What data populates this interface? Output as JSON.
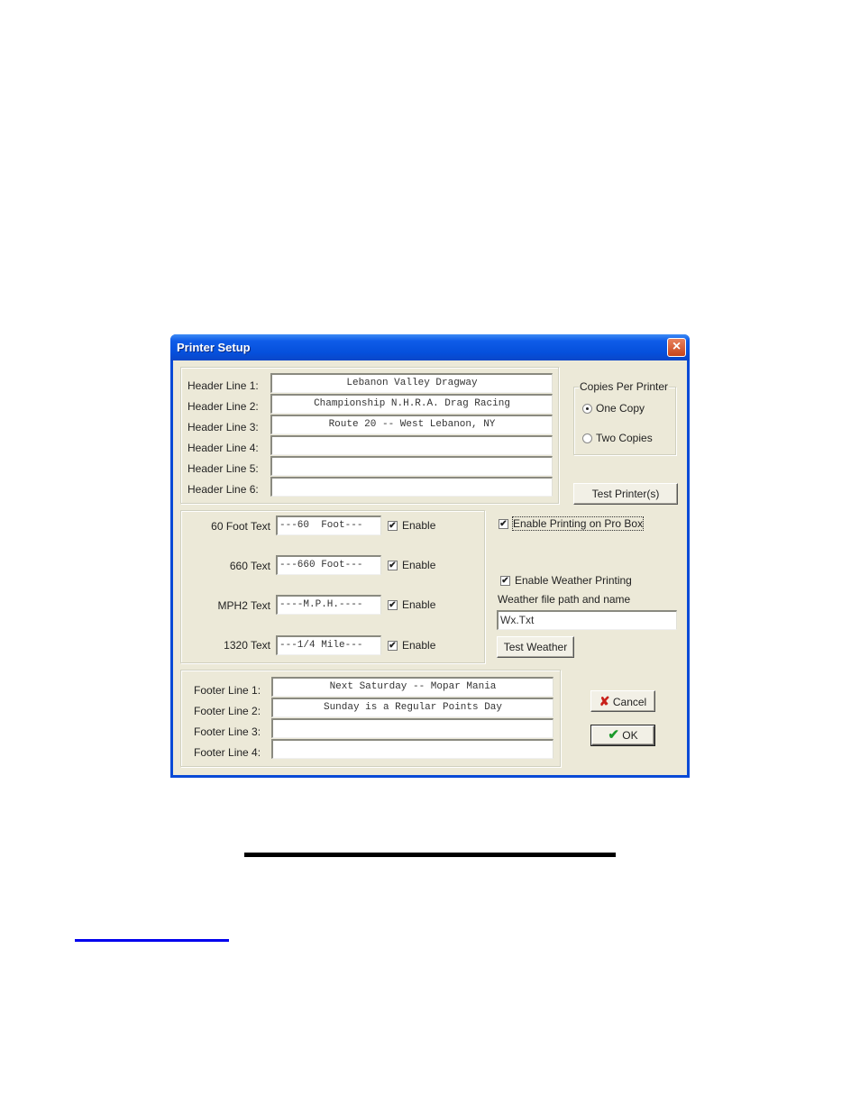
{
  "window": {
    "title": "Printer Setup",
    "close_icon": "close-icon"
  },
  "header_lines": [
    {
      "label": "Header Line 1:",
      "value": "Lebanon Valley Dragway"
    },
    {
      "label": "Header Line 2:",
      "value": "Championship N.H.R.A. Drag Racing"
    },
    {
      "label": "Header Line 3:",
      "value": "Route 20 -- West Lebanon, NY"
    },
    {
      "label": "Header Line 4:",
      "value": ""
    },
    {
      "label": "Header Line 5:",
      "value": ""
    },
    {
      "label": "Header Line 6:",
      "value": ""
    }
  ],
  "copies": {
    "legend": "Copies Per Printer",
    "options": [
      {
        "label": "One Copy",
        "selected": true
      },
      {
        "label": "Two Copies",
        "selected": false
      }
    ]
  },
  "test_printer_label": "Test Printer(s)",
  "timing_texts": [
    {
      "label": "60 Foot Text",
      "value": "---60  Foot---",
      "enable_label": "Enable",
      "enabled": true
    },
    {
      "label": "660 Text",
      "value": "---660 Foot---",
      "enable_label": "Enable",
      "enabled": true
    },
    {
      "label": "MPH2 Text",
      "value": "----M.P.H.----",
      "enable_label": "Enable",
      "enabled": true
    },
    {
      "label": "1320 Text",
      "value": "---1/4 Mile---",
      "enable_label": "Enable",
      "enabled": true
    }
  ],
  "pro_box": {
    "label": "Enable Printing on Pro Box",
    "checked": true
  },
  "weather": {
    "enable_label": "Enable Weather Printing",
    "checked": true,
    "path_label": "Weather file path and name",
    "path_value": "Wx.Txt",
    "test_label": "Test Weather"
  },
  "footer_lines": [
    {
      "label": "Footer Line 1:",
      "value": "Next Saturday -- Mopar Mania"
    },
    {
      "label": "Footer Line 2:",
      "value": "Sunday is a Regular Points Day"
    },
    {
      "label": "Footer Line 3:",
      "value": ""
    },
    {
      "label": "Footer Line 4:",
      "value": ""
    }
  ],
  "buttons": {
    "cancel_label": "Cancel",
    "ok_label": "OK"
  },
  "colors": {
    "titlebar": "#0550dc",
    "dialog_bg": "#ece9d8",
    "cancel_icon": "#c8201a",
    "ok_icon": "#1a9a2a",
    "link": "#0000ee"
  },
  "check_glyph": "✔",
  "cancel_glyph": "✘",
  "ok_glyph": "✔"
}
